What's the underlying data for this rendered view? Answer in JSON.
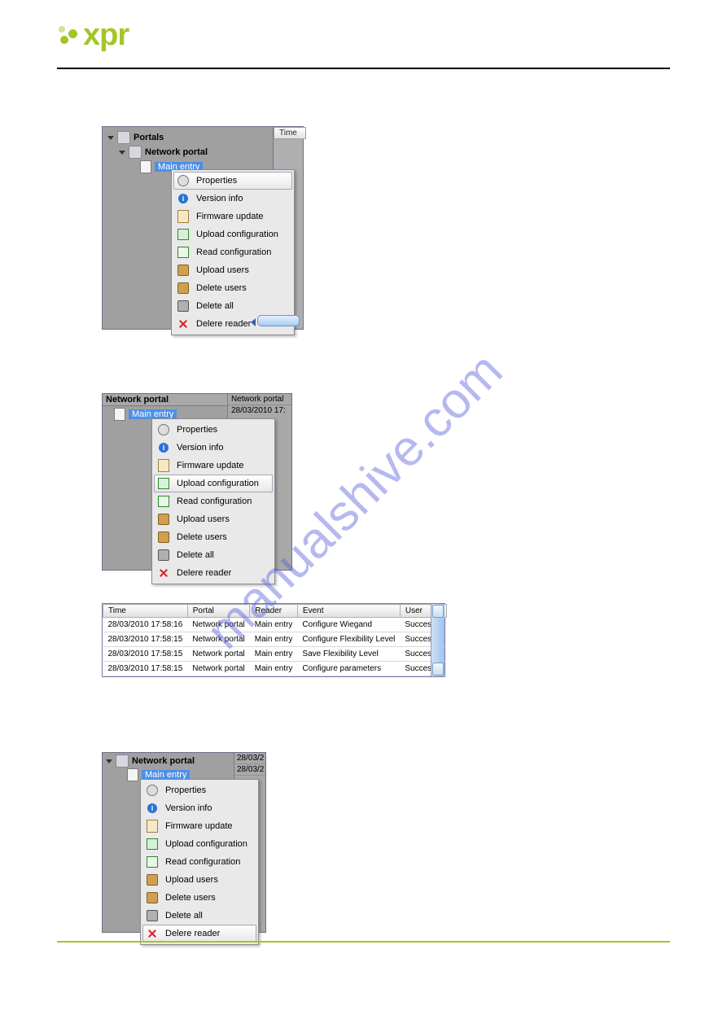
{
  "logo_text": "xpr",
  "watermark": "manualshive.com",
  "panel1": {
    "tree_root": "Portals",
    "tree_portal": "Network portal",
    "tree_selected": "Main entry",
    "time_header": "Time",
    "menu": {
      "properties": "Properties",
      "version": "Version info",
      "firmware": "Firmware update",
      "upload_cfg": "Upload configuration",
      "read_cfg": "Read configuration",
      "upload_users": "Upload users",
      "delete_users": "Delete users",
      "delete_all": "Delete all",
      "delete_reader": "Delere reader"
    }
  },
  "panel2": {
    "title_cut": "Network portal",
    "selected": "Main entry",
    "timestamp": "28/03/2010 17:",
    "portal_cell": "Network portal",
    "menu": {
      "properties": "Properties",
      "version": "Version info",
      "firmware": "Firmware update",
      "upload_cfg": "Upload configuration",
      "read_cfg": "Read configuration",
      "upload_users": "Upload users",
      "delete_users": "Delete users",
      "delete_all": "Delete all",
      "delete_reader": "Delere reader"
    }
  },
  "events": {
    "headers": {
      "time": "Time",
      "portal": "Portal",
      "reader": "Reader",
      "event": "Event",
      "user": "User"
    },
    "rows": [
      {
        "time": "28/03/2010 17:58:16",
        "portal": "Network portal",
        "reader": "Main entry",
        "event": "Configure Wiegand",
        "user": "Succes"
      },
      {
        "time": "28/03/2010 17:58:15",
        "portal": "Network portal",
        "reader": "Main entry",
        "event": "Configure Flexibility Level",
        "user": "Succes"
      },
      {
        "time": "28/03/2010 17:58:15",
        "portal": "Network portal",
        "reader": "Main entry",
        "event": "Save Flexibility Level",
        "user": "Succes"
      },
      {
        "time": "28/03/2010 17:58:15",
        "portal": "Network portal",
        "reader": "Main entry",
        "event": "Configure parameters",
        "user": "Succes"
      }
    ]
  },
  "panel4": {
    "portal": "Network portal",
    "selected": "Main entry",
    "date_a": "28/03/2",
    "date_b": "28/03/2",
    "menu": {
      "properties": "Properties",
      "version": "Version info",
      "firmware": "Firmware update",
      "upload_cfg": "Upload configuration",
      "read_cfg": "Read configuration",
      "upload_users": "Upload users",
      "delete_users": "Delete users",
      "delete_all": "Delete all",
      "delete_reader": "Delere reader"
    }
  }
}
